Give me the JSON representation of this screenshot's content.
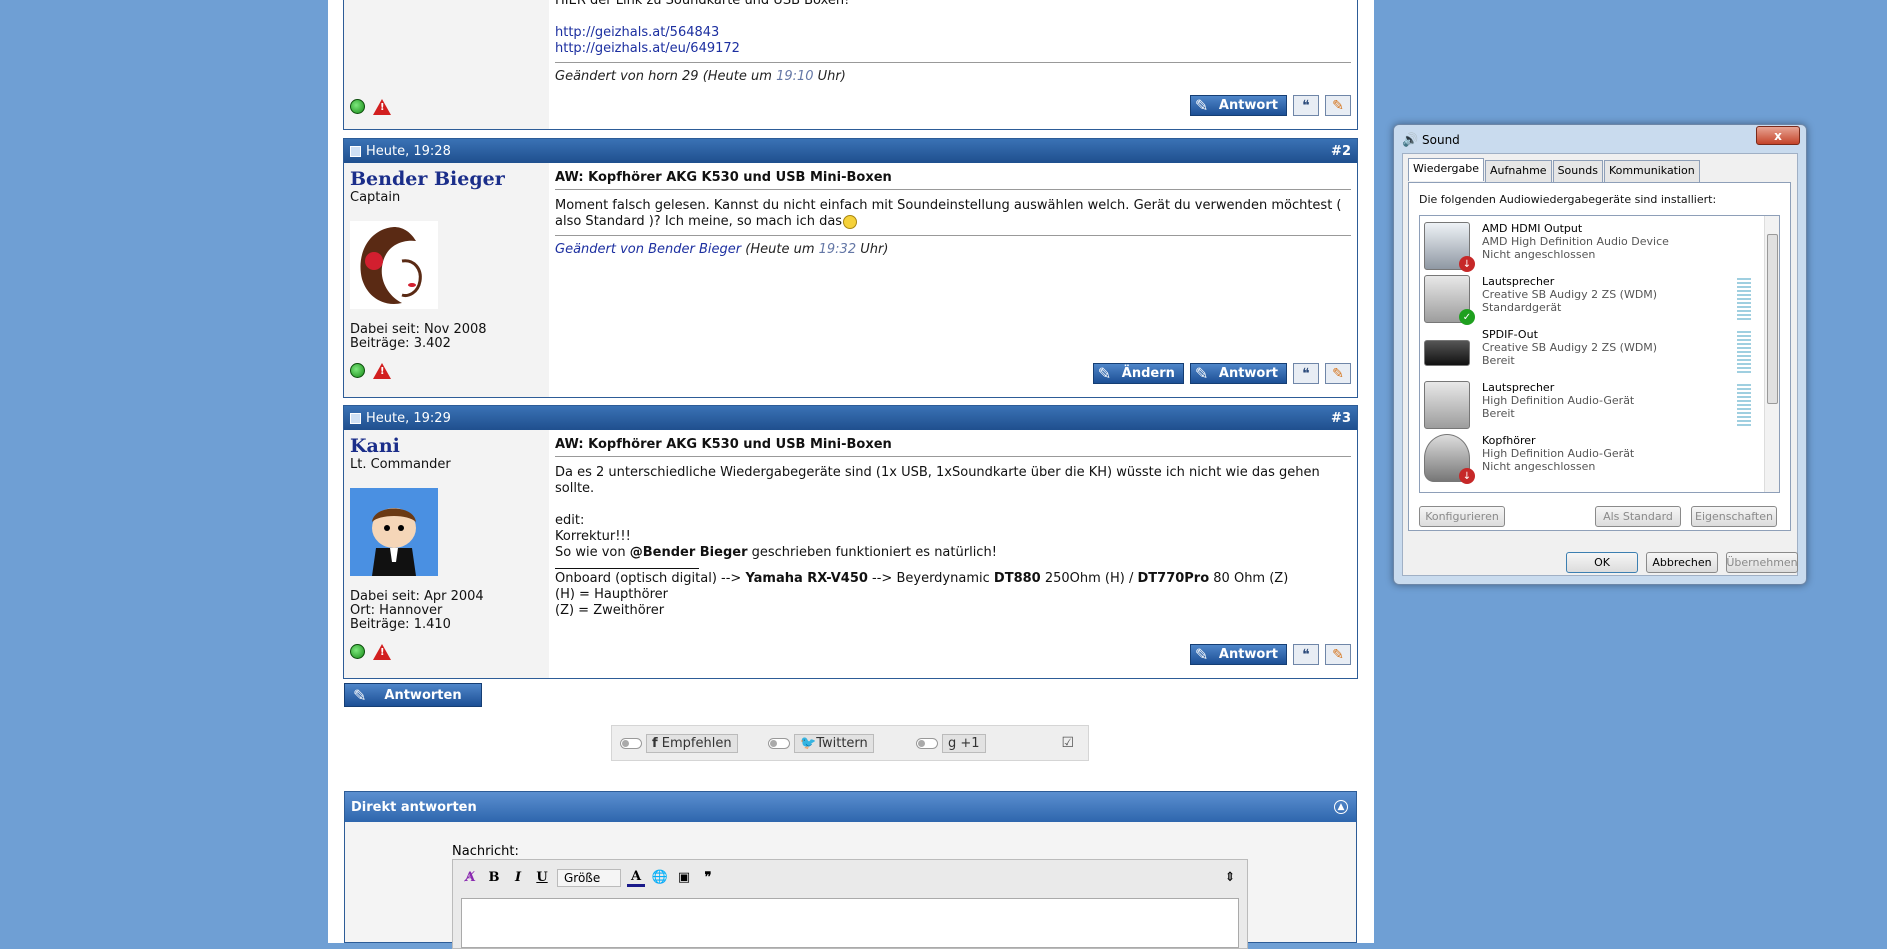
{
  "post1": {
    "line_top": "HIER der Link zu Soundkarte und USB Boxen!",
    "links": [
      "http://geizhals.at/564843",
      "http://geizhals.at/eu/649172"
    ],
    "edited_prefix": "Geändert von horn 29 (Heute um ",
    "edited_time": "19:10",
    "edited_suffix": " Uhr)",
    "reply_label": "Antwort"
  },
  "post2": {
    "date": "Heute, 19:28",
    "number": "#2",
    "username": "Bender Bieger",
    "rank": "Captain",
    "joined": "Dabei seit: Nov 2008",
    "posts": "Beiträge: 3.402",
    "title": "AW: Kopfhörer AKG K530 und USB Mini-Boxen",
    "body": "Moment falsch gelesen. Kannst du nicht einfach mit Soundeinstellung auswählen welch. Gerät du verwenden möchtest ( also Standard )? Ich meine, so mach ich das",
    "edited_prefix": "Geändert von ",
    "edited_user": "Bender Bieger",
    "edited_mid": " (Heute um ",
    "edited_time": "19:32",
    "edited_suffix": " Uhr)",
    "edit_label": "Ändern",
    "reply_label": "Antwort"
  },
  "post3": {
    "date": "Heute, 19:29",
    "number": "#3",
    "username": "Kani",
    "rank": "Lt. Commander",
    "joined": "Dabei seit: Apr 2004",
    "location": "Ort: Hannover",
    "posts": "Beiträge: 1.410",
    "title": "AW: Kopfhörer AKG K530 und USB Mini-Boxen",
    "body1": "Da es 2 unterschiedliche Wiedergabegeräte sind (1x USB, 1xSoundkarte über die KH) wüsste ich nicht wie das gehen sollte.",
    "edit1": "edit:",
    "edit2": "Korrektur!!!",
    "edit3_pre": "So wie von ",
    "edit3_user": "@Bender Bieger",
    "edit3_post": " geschrieben funktioniert es natürlich!",
    "sig1_a": "Onboard (optisch digital) --> ",
    "sig1_b": "Yamaha RX-V450",
    "sig1_c": " --> Beyerdynamic ",
    "sig1_d": "DT880",
    "sig1_e": " 250Ohm (H) / ",
    "sig1_f": "DT770Pro",
    "sig1_g": " 80 Ohm (Z)",
    "sig2": "(H) = Haupthörer",
    "sig3": "(Z) = Zweithörer",
    "reply_label": "Antwort"
  },
  "reply_button": "Antworten",
  "social": {
    "facebook": "Empfehlen",
    "twitter": "Twittern",
    "gplus": "+1"
  },
  "direct": {
    "header": "Direkt antworten",
    "message_label": "Nachricht:",
    "size_select": "Größe"
  },
  "sound_dialog": {
    "title": "Sound",
    "close": "x",
    "tabs": [
      "Wiedergabe",
      "Aufnahme",
      "Sounds",
      "Kommunikation"
    ],
    "intro": "Die folgenden Audiowiedergabegeräte sind installiert:",
    "devices": [
      {
        "name": "AMD HDMI Output",
        "driver": "AMD High Definition Audio Device",
        "status": "Nicht angeschlossen"
      },
      {
        "name": "Lautsprecher",
        "driver": "Creative SB Audigy 2 ZS (WDM)",
        "status": "Standardgerät"
      },
      {
        "name": "SPDIF-Out",
        "driver": "Creative SB Audigy 2 ZS (WDM)",
        "status": "Bereit"
      },
      {
        "name": "Lautsprecher",
        "driver": "High Definition Audio-Gerät",
        "status": "Bereit"
      },
      {
        "name": "Kopfhörer",
        "driver": "High Definition Audio-Gerät",
        "status": "Nicht angeschlossen"
      }
    ],
    "configure": "Konfigurieren",
    "set_default": "Als Standard",
    "properties": "Eigenschaften",
    "ok": "OK",
    "cancel": "Abbrechen",
    "apply": "Übernehmen"
  }
}
